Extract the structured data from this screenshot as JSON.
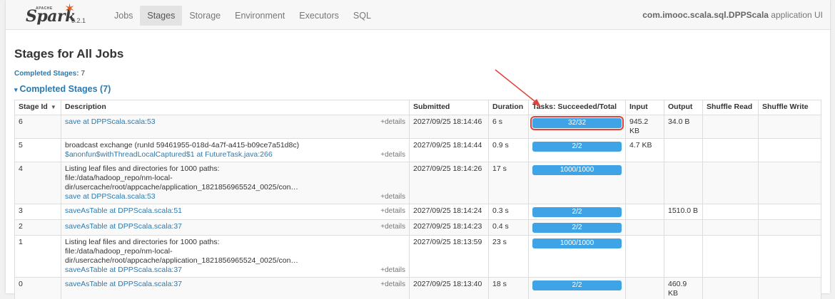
{
  "brand": {
    "apache": "APACHE",
    "name": "Spark",
    "version": "3.2.1"
  },
  "nav": {
    "items": [
      {
        "label": "Jobs",
        "active": false
      },
      {
        "label": "Stages",
        "active": true
      },
      {
        "label": "Storage",
        "active": false
      },
      {
        "label": "Environment",
        "active": false
      },
      {
        "label": "Executors",
        "active": false
      },
      {
        "label": "SQL",
        "active": false
      }
    ],
    "app_name": "com.imooc.scala.sql.DPPScala",
    "app_suffix": " application UI"
  },
  "page": {
    "title": "Stages for All Jobs",
    "summary_label": "Completed Stages:",
    "summary_value": " 7",
    "section_header": "Completed Stages (7)"
  },
  "table": {
    "headers": [
      "Stage Id",
      "Description",
      "Submitted",
      "Duration",
      "Tasks: Succeeded/Total",
      "Input",
      "Output",
      "Shuffle Read",
      "Shuffle Write"
    ],
    "details_label": "+details",
    "rows": [
      {
        "id": "6",
        "desc_lines": [],
        "link": "save at DPPScala.scala:53",
        "submitted": "2027/09/25 18:14:46",
        "duration": "6 s",
        "tasks": "32/32",
        "progress": 1.0,
        "input": "945.2 KB",
        "output": "34.0 B",
        "shuffle_read": "",
        "shuffle_write": ""
      },
      {
        "id": "5",
        "desc_lines": [
          "broadcast exchange (runId 59461955-018d-4a7f-a415-b09ce7a51d8c)"
        ],
        "link": "$anonfun$withThreadLocalCaptured$1 at FutureTask.java:266",
        "submitted": "2027/09/25 18:14:44",
        "duration": "0.9 s",
        "tasks": "2/2",
        "progress": 1.0,
        "input": "4.7 KB",
        "output": "",
        "shuffle_read": "",
        "shuffle_write": ""
      },
      {
        "id": "4",
        "desc_lines": [
          "Listing leaf files and directories for 1000 paths:",
          "file:/data/hadoop_repo/nm-local-dir/usercache/root/appcache/application_1821856965524_0025/con…"
        ],
        "link": "save at DPPScala.scala:53",
        "submitted": "2027/09/25 18:14:26",
        "duration": "17 s",
        "tasks": "1000/1000",
        "progress": 1.0,
        "input": "",
        "output": "",
        "shuffle_read": "",
        "shuffle_write": ""
      },
      {
        "id": "3",
        "desc_lines": [],
        "link": "saveAsTable at DPPScala.scala:51",
        "submitted": "2027/09/25 18:14:24",
        "duration": "0.3 s",
        "tasks": "2/2",
        "progress": 1.0,
        "input": "",
        "output": "1510.0 B",
        "shuffle_read": "",
        "shuffle_write": ""
      },
      {
        "id": "2",
        "desc_lines": [],
        "link": "saveAsTable at DPPScala.scala:37",
        "submitted": "2027/09/25 18:14:23",
        "duration": "0.4 s",
        "tasks": "2/2",
        "progress": 1.0,
        "input": "",
        "output": "",
        "shuffle_read": "",
        "shuffle_write": ""
      },
      {
        "id": "1",
        "desc_lines": [
          "Listing leaf files and directories for 1000 paths:",
          "file:/data/hadoop_repo/nm-local-dir/usercache/root/appcache/application_1821856965524_0025/con…"
        ],
        "link": "saveAsTable at DPPScala.scala:37",
        "submitted": "2027/09/25 18:13:59",
        "duration": "23 s",
        "tasks": "1000/1000",
        "progress": 1.0,
        "input": "",
        "output": "",
        "shuffle_read": "",
        "shuffle_write": ""
      },
      {
        "id": "0",
        "desc_lines": [],
        "link": "saveAsTable at DPPScala.scala:37",
        "submitted": "2027/09/25 18:13:40",
        "duration": "18 s",
        "tasks": "2/2",
        "progress": 1.0,
        "input": "",
        "output": "460.9 KB",
        "shuffle_read": "",
        "shuffle_write": ""
      }
    ]
  },
  "colors": {
    "link": "#2a7ab0",
    "progress": "#3ea4e6",
    "annotation": "#e0413a",
    "brand_star": "#e25a1c"
  },
  "icons": {
    "sort": "sort-down-icon",
    "expand": "collapse-triangle-icon",
    "annotation": "red-arrow-icon"
  }
}
